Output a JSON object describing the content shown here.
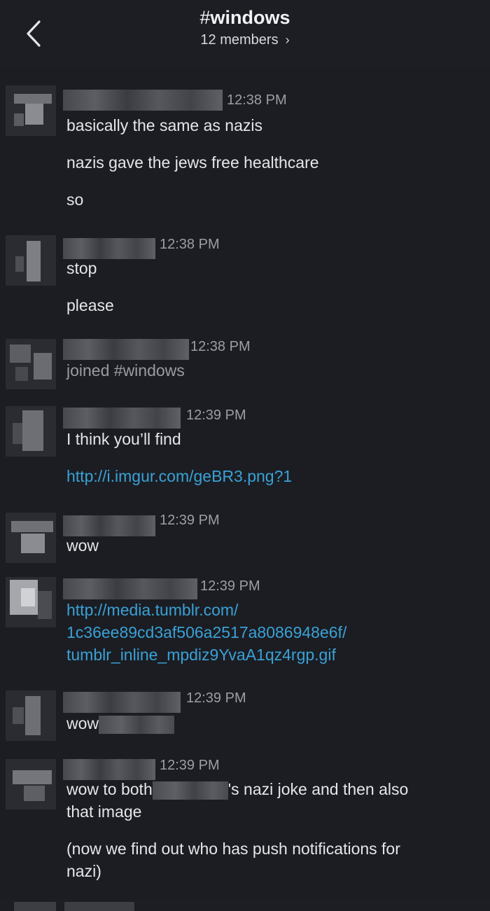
{
  "header": {
    "hash": "#",
    "channel_name": "windows",
    "members": "12 members",
    "members_chevron": "›"
  },
  "messages": [
    {
      "time": "12:38 PM",
      "lines": [
        "basically the same as nazis",
        "nazis gave the jews free healthcare",
        "so"
      ]
    },
    {
      "time": "12:38 PM",
      "lines": [
        "stop",
        "please"
      ]
    },
    {
      "time": "12:38 PM",
      "system": "joined #windows"
    },
    {
      "time": "12:39 PM",
      "lines": [
        "I think you’ll find"
      ],
      "link": "http://i.imgur.com/geBR3.png?1"
    },
    {
      "time": "12:39 PM",
      "lines": [
        "wow"
      ]
    },
    {
      "time": "12:39 PM",
      "link_lines": [
        "http://media.tumblr.com/",
        "1c36ee89cd3af506a2517a8086948e6f/",
        "tumblr_inline_mpdiz9YvaA1qz4rgp.gif"
      ]
    },
    {
      "time": "12:39 PM",
      "wow_prefix": "wow"
    },
    {
      "time": "12:39 PM",
      "line1_prefix": "wow to both",
      "line1_suffix": "'s nazi joke and then also",
      "line2": "that image",
      "line3": "(now we find out who has push notifications for",
      "line4": "nazi)"
    }
  ],
  "colors": {
    "background": "#1b1d22",
    "text": "#e6e6e9",
    "timestamp": "#9c9ea3",
    "link": "#3aa1d6"
  }
}
